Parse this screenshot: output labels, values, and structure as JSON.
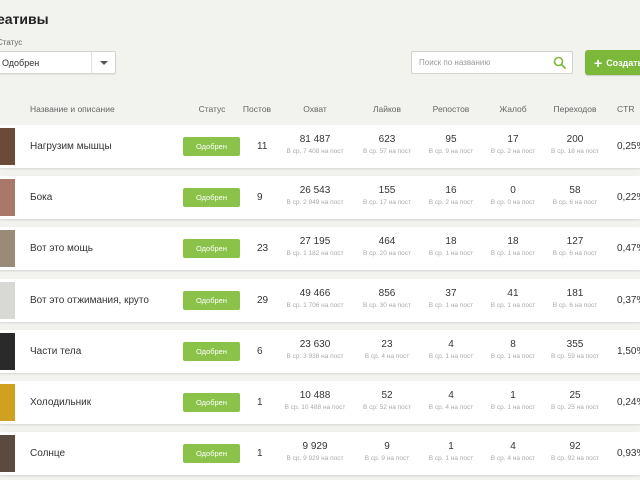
{
  "page": {
    "title": "еативы"
  },
  "filter": {
    "status_label": "Статус",
    "status_value": "Одобрен"
  },
  "search": {
    "placeholder": "Поиск по названию"
  },
  "toolbar": {
    "create_label": "Создать"
  },
  "colors": {
    "accent": "#7cb83a",
    "badge": "#8bc34a",
    "background": "#f2f2ef"
  },
  "columns": {
    "name": "Название и описание",
    "status": "Статус",
    "posts": "Постов",
    "reach": "Охват",
    "likes": "Лайков",
    "reposts": "Репостов",
    "complaints": "Жалоб",
    "clicks": "Переходов",
    "ctr": "CTR"
  },
  "rows": [
    {
      "name": "Нагрузим мышцы",
      "status": "Одобрен",
      "posts": "11",
      "reach": "81 487",
      "reach_avg": "В ср. 7 408 на пост",
      "likes": "623",
      "likes_avg": "В ср. 57 на пост",
      "reposts": "95",
      "reposts_avg": "В ср. 9 на пост",
      "complaints": "17",
      "complaints_avg": "В ср. 2 на пост",
      "clicks": "200",
      "clicks_avg": "В ср. 18 на пост",
      "ctr": "0,25%",
      "thumb_color": "#6b4a38"
    },
    {
      "name": "Бока",
      "status": "Одобрен",
      "posts": "9",
      "reach": "26 543",
      "reach_avg": "В ср. 2 949 на пост",
      "likes": "155",
      "likes_avg": "В ср. 17 на пост",
      "reposts": "16",
      "reposts_avg": "В ср. 2 на пост",
      "complaints": "0",
      "complaints_avg": "В ср. 0 на пост",
      "clicks": "58",
      "clicks_avg": "В ср. 6 на пост",
      "ctr": "0,22%",
      "thumb_color": "#a87868"
    },
    {
      "name": "Вот это мощь",
      "status": "Одобрен",
      "posts": "23",
      "reach": "27 195",
      "reach_avg": "В ср. 1 182 на пост",
      "likes": "464",
      "likes_avg": "В ср. 20 на пост",
      "reposts": "18",
      "reposts_avg": "В ср. 1 на пост",
      "complaints": "18",
      "complaints_avg": "В ср. 1 на пост",
      "clicks": "127",
      "clicks_avg": "В ср. 6 на пост",
      "ctr": "0,47%",
      "thumb_color": "#9a8a78"
    },
    {
      "name": "Вот это отжимания, круто",
      "status": "Одобрен",
      "posts": "29",
      "reach": "49 466",
      "reach_avg": "В ср. 1 706 на пост",
      "likes": "856",
      "likes_avg": "В ср. 30 на пост",
      "reposts": "37",
      "reposts_avg": "В ср. 1 на пост",
      "complaints": "41",
      "complaints_avg": "В ср. 1 на пост",
      "clicks": "181",
      "clicks_avg": "В ср. 6 на пост",
      "ctr": "0,37%",
      "thumb_color": "#d8d8d4"
    },
    {
      "name": "Части тела",
      "status": "Одобрен",
      "posts": "6",
      "reach": "23 630",
      "reach_avg": "В ср. 3 938 на пост",
      "likes": "23",
      "likes_avg": "В ср. 4 на пост",
      "reposts": "4",
      "reposts_avg": "В ср. 1 на пост",
      "complaints": "8",
      "complaints_avg": "В ср. 1 на пост",
      "clicks": "355",
      "clicks_avg": "В ср. 59 на пост",
      "ctr": "1,50%",
      "thumb_color": "#2a2a2a"
    },
    {
      "name": "Холодильник",
      "status": "Одобрен",
      "posts": "1",
      "reach": "10 488",
      "reach_avg": "В ср. 10 488 на пост",
      "likes": "52",
      "likes_avg": "В ср. 52 на пост",
      "reposts": "4",
      "reposts_avg": "В ср. 4 на пост",
      "complaints": "1",
      "complaints_avg": "В ср. 1 на пост",
      "clicks": "25",
      "clicks_avg": "В ср. 25 на пост",
      "ctr": "0,24%",
      "thumb_color": "#d0a020"
    },
    {
      "name": "Солнце",
      "status": "Одобрен",
      "posts": "1",
      "reach": "9 929",
      "reach_avg": "В ср. 9 929 на пост",
      "likes": "9",
      "likes_avg": "В ср. 9 на пост",
      "reposts": "1",
      "reposts_avg": "В ср. 1 на пост",
      "complaints": "4",
      "complaints_avg": "В ср. 4 на пост",
      "clicks": "92",
      "clicks_avg": "В ср. 92 на пост",
      "ctr": "0,93%",
      "thumb_color": "#5a4a40"
    }
  ]
}
